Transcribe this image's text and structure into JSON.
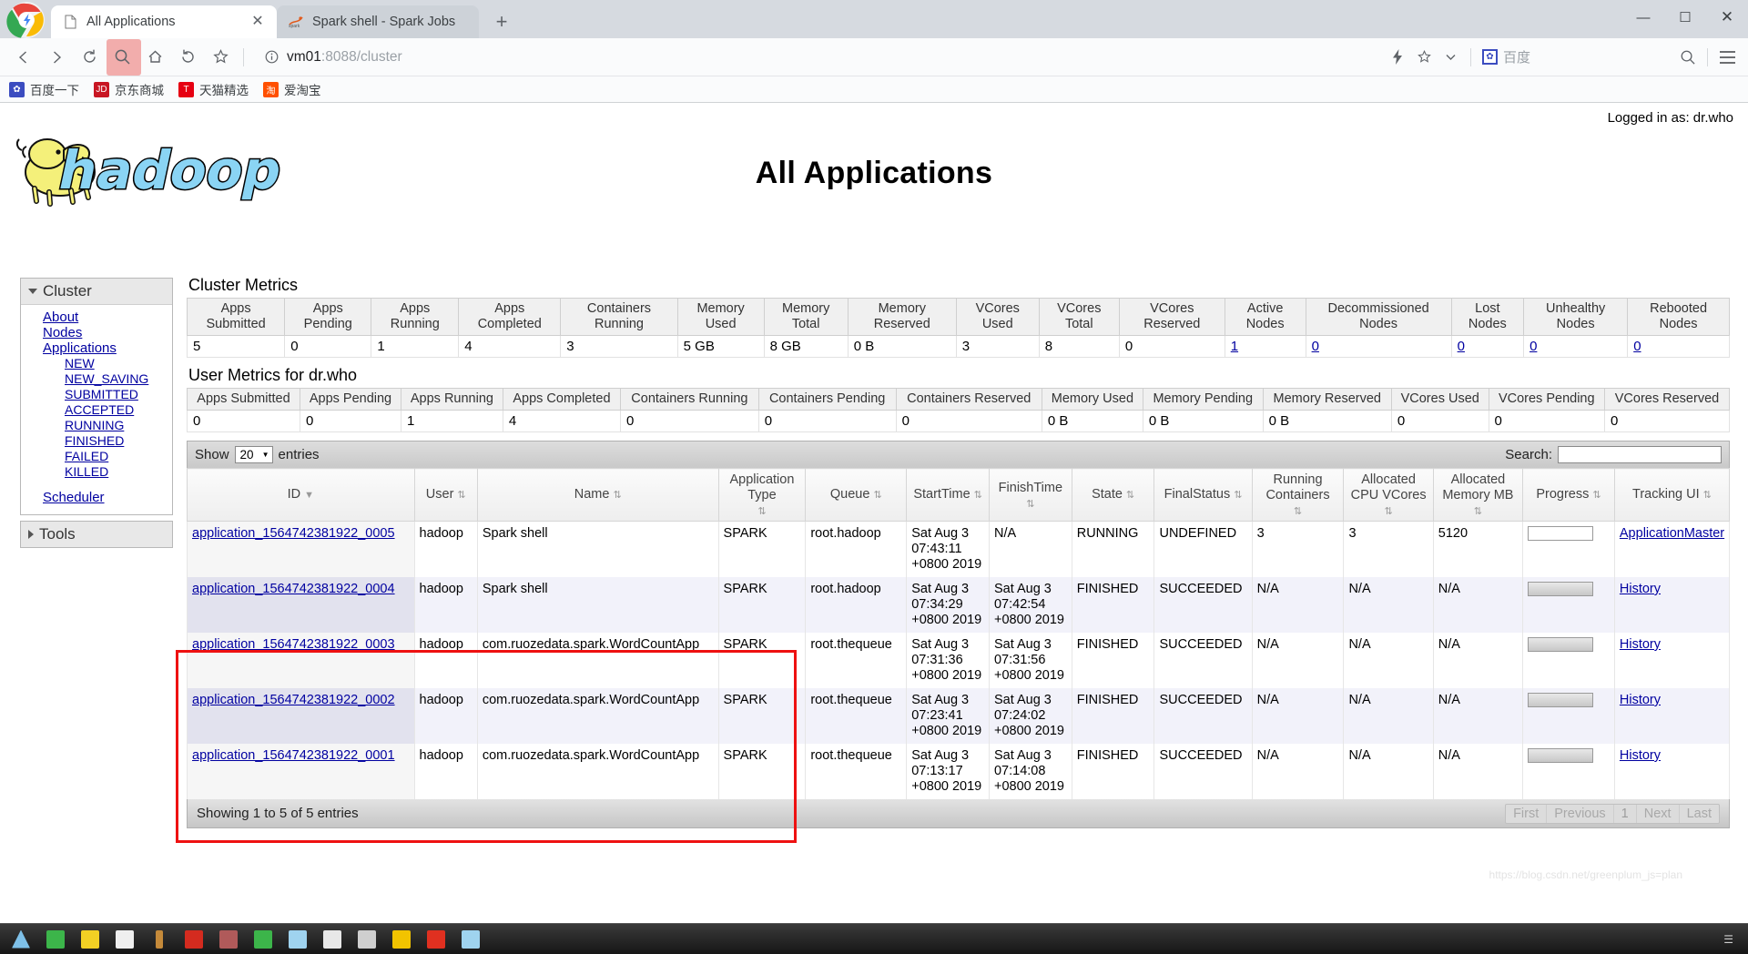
{
  "browser": {
    "tabs": [
      {
        "title": "All Applications",
        "favicon": "page-icon",
        "active": true,
        "close_label": "✕"
      },
      {
        "title": "Spark shell - Spark Jobs",
        "favicon": "spark-icon",
        "active": false,
        "close_label": ""
      }
    ],
    "new_tab_label": "+",
    "window_controls": {
      "minimize": "—",
      "maximize": "☐",
      "close": "✕"
    },
    "toolbar": {
      "back_label": "back-arrow",
      "forward_label": "forward-arrow",
      "reload_label": "reload",
      "search_label": "search",
      "home_label": "home",
      "undo_label": "undo",
      "bookmark_label": "star",
      "url_host": "vm01",
      "url_rest": ":8088/cluster",
      "lightning_label": "⚡",
      "star_label": "☆",
      "chevron_label": "⌄",
      "baidu_label": "百度",
      "baidu_icon_glyph": "✿",
      "search_right_label": "search",
      "menu_label": "menu"
    },
    "bookmarks": [
      {
        "label": "百度一下",
        "icon_text": "✿",
        "icon_color": "#3b4cc0"
      },
      {
        "label": "京东商城",
        "icon_text": "JD",
        "icon_color": "#c81623"
      },
      {
        "label": "天猫精选",
        "icon_text": "T",
        "icon_color": "#e60012"
      },
      {
        "label": "爱淘宝",
        "icon_text": "淘",
        "icon_color": "#ff5000"
      }
    ]
  },
  "page": {
    "logged_in": "Logged in as: dr.who",
    "title": "All Applications",
    "logo_alt": "hadoop"
  },
  "sidebar": {
    "cluster": {
      "header": "Cluster",
      "links": [
        "About",
        "Nodes",
        "Applications"
      ],
      "sub_links": [
        "NEW",
        "NEW_SAVING",
        "SUBMITTED",
        "ACCEPTED",
        "RUNNING",
        "FINISHED",
        "FAILED",
        "KILLED"
      ],
      "scheduler": "Scheduler"
    },
    "tools": {
      "header": "Tools"
    }
  },
  "cluster_metrics": {
    "title": "Cluster Metrics",
    "headers": [
      "Apps Submitted",
      "Apps Pending",
      "Apps Running",
      "Apps Completed",
      "Containers Running",
      "Memory Used",
      "Memory Total",
      "Memory Reserved",
      "VCores Used",
      "VCores Total",
      "VCores Reserved",
      "Active Nodes",
      "Decommissioned Nodes",
      "Lost Nodes",
      "Unhealthy Nodes",
      "Rebooted Nodes"
    ],
    "values": [
      "5",
      "0",
      "1",
      "4",
      "3",
      "5 GB",
      "8 GB",
      "0 B",
      "3",
      "8",
      "0",
      "1",
      "0",
      "0",
      "0",
      "0"
    ],
    "link_indices": [
      11,
      12,
      13,
      14,
      15
    ]
  },
  "user_metrics": {
    "title": "User Metrics for dr.who",
    "headers": [
      "Apps Submitted",
      "Apps Pending",
      "Apps Running",
      "Apps Completed",
      "Containers Running",
      "Containers Pending",
      "Containers Reserved",
      "Memory Used",
      "Memory Pending",
      "Memory Reserved",
      "VCores Used",
      "VCores Pending",
      "VCores Reserved"
    ],
    "values": [
      "0",
      "0",
      "1",
      "4",
      "0",
      "0",
      "0",
      "0 B",
      "0 B",
      "0 B",
      "0",
      "0",
      "0"
    ]
  },
  "datatable": {
    "show_label": "Show",
    "entries_label": "entries",
    "page_size": "20",
    "search_label": "Search:",
    "search_value": "",
    "search_placeholder": "",
    "columns": [
      "ID",
      "User",
      "Name",
      "Application Type",
      "Queue",
      "StartTime",
      "FinishTime",
      "State",
      "FinalStatus",
      "Running Containers",
      "Allocated CPU VCores",
      "Allocated Memory MB",
      "Progress",
      "Tracking UI"
    ],
    "rows": [
      {
        "id": "application_1564742381922_0005",
        "user": "hadoop",
        "name": "Spark shell",
        "app_type": "SPARK",
        "queue": "root.hadoop",
        "start_time": "Sat Aug 3 07:43:11 +0800 2019",
        "finish_time": "N/A",
        "state": "RUNNING",
        "final_status": "UNDEFINED",
        "running_containers": "3",
        "allocated_cpu_vcores": "3",
        "allocated_memory_mb": "5120",
        "progress_filled": false,
        "tracking_ui": "ApplicationMaster"
      },
      {
        "id": "application_1564742381922_0004",
        "user": "hadoop",
        "name": "Spark shell",
        "app_type": "SPARK",
        "queue": "root.hadoop",
        "start_time": "Sat Aug 3 07:34:29 +0800 2019",
        "finish_time": "Sat Aug 3 07:42:54 +0800 2019",
        "state": "FINISHED",
        "final_status": "SUCCEEDED",
        "running_containers": "N/A",
        "allocated_cpu_vcores": "N/A",
        "allocated_memory_mb": "N/A",
        "progress_filled": true,
        "tracking_ui": "History"
      },
      {
        "id": "application_1564742381922_0003",
        "user": "hadoop",
        "name": "com.ruozedata.spark.WordCountApp",
        "app_type": "SPARK",
        "queue": "root.thequeue",
        "start_time": "Sat Aug 3 07:31:36 +0800 2019",
        "finish_time": "Sat Aug 3 07:31:56 +0800 2019",
        "state": "FINISHED",
        "final_status": "SUCCEEDED",
        "running_containers": "N/A",
        "allocated_cpu_vcores": "N/A",
        "allocated_memory_mb": "N/A",
        "progress_filled": true,
        "tracking_ui": "History"
      },
      {
        "id": "application_1564742381922_0002",
        "user": "hadoop",
        "name": "com.ruozedata.spark.WordCountApp",
        "app_type": "SPARK",
        "queue": "root.thequeue",
        "start_time": "Sat Aug 3 07:23:41 +0800 2019",
        "finish_time": "Sat Aug 3 07:24:02 +0800 2019",
        "state": "FINISHED",
        "final_status": "SUCCEEDED",
        "running_containers": "N/A",
        "allocated_cpu_vcores": "N/A",
        "allocated_memory_mb": "N/A",
        "progress_filled": true,
        "tracking_ui": "History"
      },
      {
        "id": "application_1564742381922_0001",
        "user": "hadoop",
        "name": "com.ruozedata.spark.WordCountApp",
        "app_type": "SPARK",
        "queue": "root.thequeue",
        "start_time": "Sat Aug 3 07:13:17 +0800 2019",
        "finish_time": "Sat Aug 3 07:14:08 +0800 2019",
        "state": "FINISHED",
        "final_status": "SUCCEEDED",
        "running_containers": "N/A",
        "allocated_cpu_vcores": "N/A",
        "allocated_memory_mb": "N/A",
        "progress_filled": true,
        "tracking_ui": "History"
      }
    ],
    "footer_status": "Showing 1 to 5 of 5 entries",
    "pager": [
      "First",
      "Previous",
      "1",
      "Next",
      "Last"
    ]
  },
  "annotation": {
    "highlight_color": "#ee1111"
  },
  "watermark": "https://blog.csdn.net/greenplum_js=plan",
  "colors": {
    "link": "#0000a0",
    "hadoop_blue": "#8ad4f4",
    "hadoop_yellow": "#f2ef5a",
    "accent_red": "#ee1111"
  }
}
